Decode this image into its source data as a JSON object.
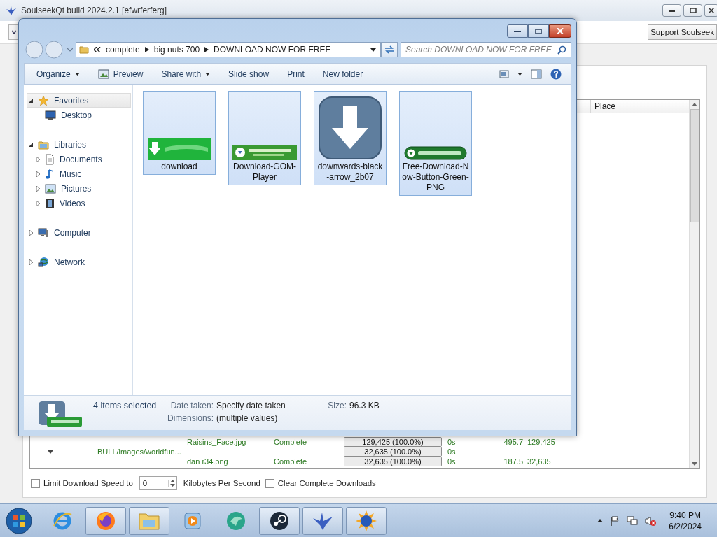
{
  "soulseek_window": {
    "title": "SoulseekQt build 2024.2.1 [efwrferferg]",
    "support_button": "Support Soulseek",
    "place_header": "Place",
    "rows": [
      {
        "file": "Raisins_Face.jpg",
        "status": "Complete",
        "progress": "129,425 (100.0%)",
        "level": 1,
        "time": "0s",
        "speed": "495.7",
        "size": "129,425"
      },
      {
        "expanded": true,
        "folder": "BULL/images/worldfun...",
        "progress": "32,635 (100.0%)",
        "level": 1,
        "time": "0s"
      },
      {
        "file": "dan r34.png",
        "status": "Complete",
        "progress": "32,635 (100.0%)",
        "level": 1,
        "time": "0s",
        "speed": "187.5",
        "size": "32,635"
      }
    ],
    "speed_limit": {
      "label": "Limit Download Speed to",
      "checked": false,
      "value": "0",
      "unit": "Kilobytes Per Second"
    },
    "clear_complete": {
      "label": "Clear Complete Downloads",
      "checked": false
    }
  },
  "explorer_window": {
    "path": [
      "complete",
      "big nuts 700",
      "DOWNLOAD NOW FOR FREE"
    ],
    "search": {
      "placeholder": "Search DOWNLOAD NOW FOR FREE"
    },
    "toolbar": [
      {
        "label": "Organize",
        "kind": "menu"
      },
      {
        "label": "Preview",
        "kind": "preview"
      },
      {
        "label": "Share with",
        "kind": "menu"
      },
      {
        "label": "Slide show",
        "kind": "plain"
      },
      {
        "label": "Print",
        "kind": "plain"
      },
      {
        "label": "New folder",
        "kind": "plain"
      }
    ],
    "nav": [
      {
        "label": "Favorites",
        "kind": "star",
        "expanded": true,
        "selected": true,
        "children": [
          {
            "label": "Desktop",
            "kind": "desktop",
            "selected": false
          }
        ]
      },
      {
        "label": "Libraries",
        "kind": "library",
        "expanded": true,
        "selected": false,
        "children": [
          {
            "label": "Documents",
            "kind": "documents",
            "expanded": false,
            "selected": false
          },
          {
            "label": "Music",
            "kind": "music",
            "expanded": false,
            "selected": false
          },
          {
            "label": "Pictures",
            "kind": "pictures",
            "expanded": false,
            "selected": false
          },
          {
            "label": "Videos",
            "kind": "videos",
            "expanded": false,
            "selected": false
          }
        ]
      },
      {
        "label": "Computer",
        "kind": "computer",
        "expanded": false,
        "selected": false
      },
      {
        "label": "Network",
        "kind": "network",
        "expanded": false,
        "selected": false
      }
    ],
    "files": [
      {
        "name": "download",
        "kind": "green-banner",
        "selected": true
      },
      {
        "name": "Download-GOM-Player",
        "kind": "small-banner",
        "selected": true
      },
      {
        "name": "downwards-black-arrow_2b07",
        "kind": "arrow-tile",
        "selected": true
      },
      {
        "name": "Free-Download-Now-Button-Green-PNG",
        "kind": "pill-button",
        "selected": true
      }
    ],
    "details": {
      "summary": "4 items selected",
      "fields": [
        {
          "label": "Date taken:",
          "value": "Specify date taken"
        },
        {
          "label": "Dimensions:",
          "value": "(multiple values)"
        },
        {
          "label": "Size:",
          "value": "96.3 KB"
        }
      ]
    }
  },
  "taskbar": {
    "apps": [
      {
        "kind": "browser-e",
        "running": false
      },
      {
        "kind": "fox",
        "running": true
      },
      {
        "kind": "folder",
        "running": true
      },
      {
        "kind": "media",
        "running": false
      },
      {
        "kind": "green-orb",
        "running": false
      },
      {
        "kind": "steam",
        "running": true
      },
      {
        "kind": "bird",
        "running": true
      },
      {
        "kind": "sun-globe",
        "running": true
      }
    ],
    "time": "9:40 PM",
    "date": "6/2/2024"
  }
}
